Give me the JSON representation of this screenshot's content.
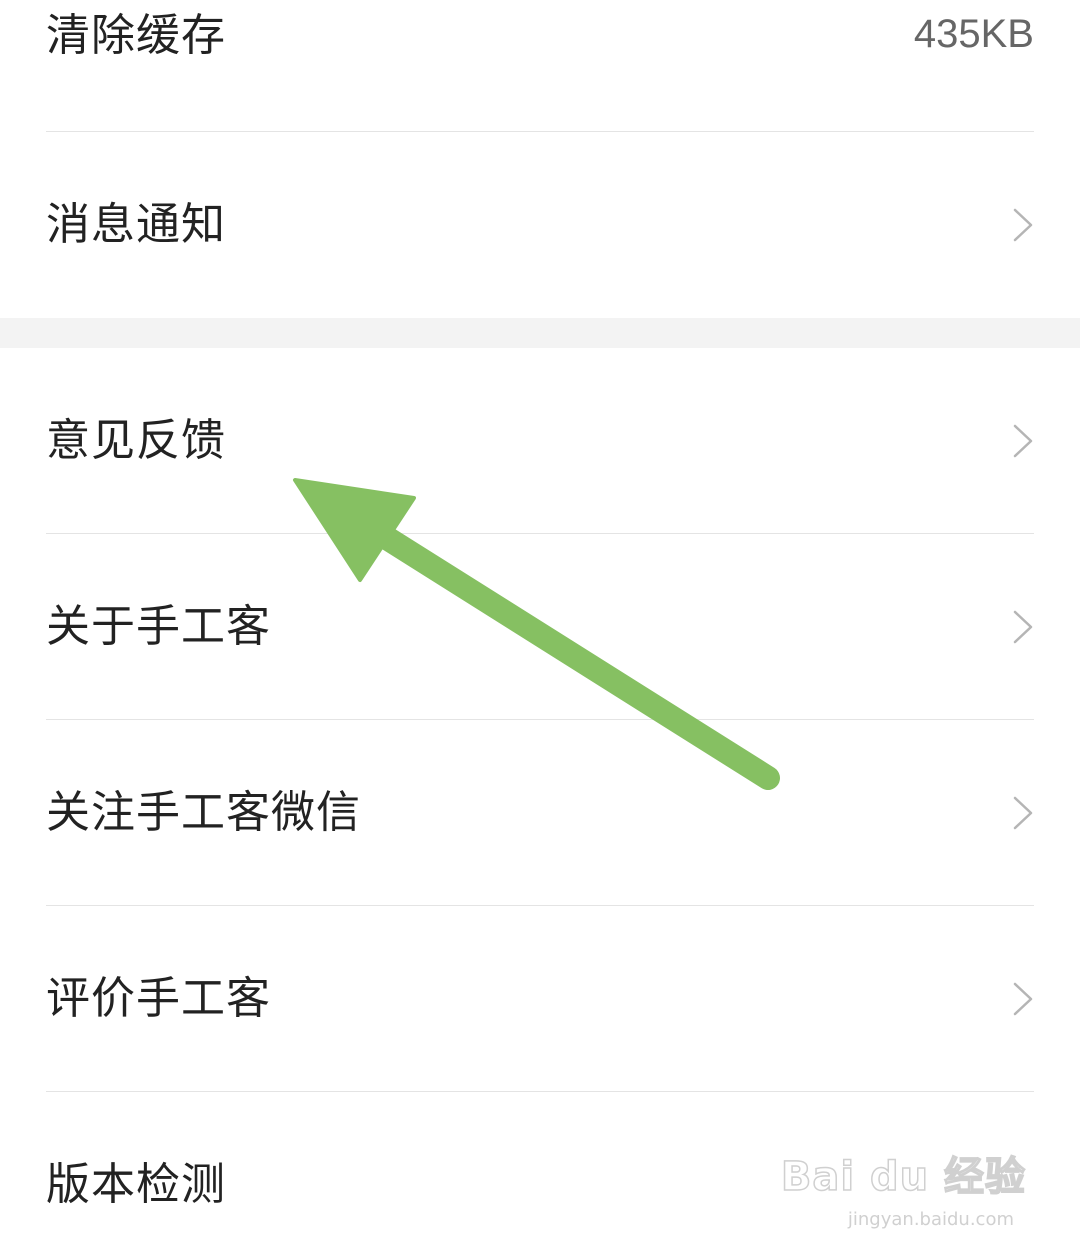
{
  "group1": {
    "clear_cache": {
      "label": "清除缓存",
      "value": "435KB"
    },
    "notifications": {
      "label": "消息通知"
    }
  },
  "group2": {
    "items": [
      {
        "label": "意见反馈"
      },
      {
        "label": "关于手工客"
      },
      {
        "label": "关注手工客微信"
      },
      {
        "label": "评价手工客"
      },
      {
        "label": "版本检测"
      }
    ]
  },
  "icons": {
    "row_chevron": "chevron-right-icon",
    "annotation": "green-arrow"
  },
  "colors": {
    "annotation_arrow": "#86c062",
    "chevron": "#b5b5b5",
    "divider": "#e4e4e4",
    "section_gap": "#f3f3f3"
  },
  "watermark": {
    "brand": "Bai du 经验",
    "url": "jingyan.baidu.com"
  }
}
